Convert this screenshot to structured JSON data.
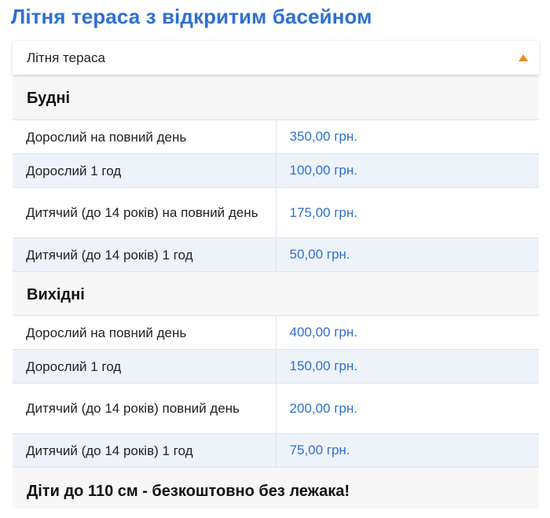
{
  "page": {
    "title": "Літня тераса з відкритим басейном"
  },
  "accordion": {
    "label": "Літня тераса",
    "expanded": true,
    "accent_color": "#f08a24"
  },
  "weekdays": {
    "title": "Будні",
    "rows": [
      {
        "label": "Дорослий на повний день",
        "price": "350,00 грн."
      },
      {
        "label": "Дорослий 1 год",
        "price": "100,00 грн."
      },
      {
        "label": "Дитячий (до 14 років) на повний день",
        "price": "175,00 грн."
      },
      {
        "label": "Дитячий (до 14 років) 1 год",
        "price": "50,00 грн."
      }
    ]
  },
  "weekends": {
    "title": "Вихідні",
    "rows": [
      {
        "label": "Дорослий на повний день",
        "price": "400,00 грн."
      },
      {
        "label": "Дорослий 1 год",
        "price": "150,00 грн."
      },
      {
        "label": "Дитячий (до 14 років) повний день",
        "price": "200,00 грн."
      },
      {
        "label": "Дитячий (до 14 років) 1 год",
        "price": "75,00 грн."
      }
    ]
  },
  "note": "Діти до 110 см - безкоштовно без лежака!",
  "colors": {
    "title": "#2f6fd1",
    "price": "#2f6fd1",
    "row_alt": "#eef3fa"
  }
}
